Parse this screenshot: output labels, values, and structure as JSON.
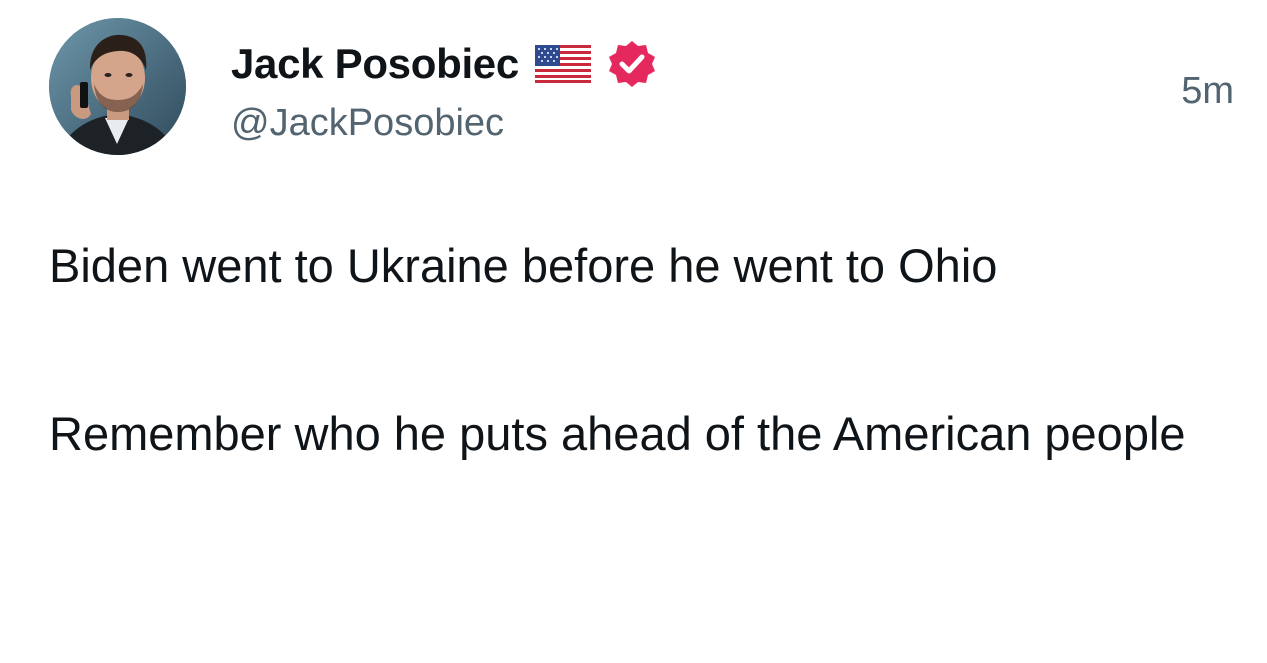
{
  "author": {
    "display_name": "Jack Posobiec",
    "handle": "@JackPosobiec",
    "badges": [
      "us-flag-icon",
      "verified-icon"
    ]
  },
  "post": {
    "timestamp": "5m",
    "paragraphs": [
      "Biden went to Ukraine before he went to Ohio",
      "Remember who he puts ahead of the American people"
    ]
  },
  "colors": {
    "text_primary": "#0f1419",
    "text_secondary": "#536471",
    "verified_badge": "#e5295f",
    "background": "#ffffff"
  }
}
